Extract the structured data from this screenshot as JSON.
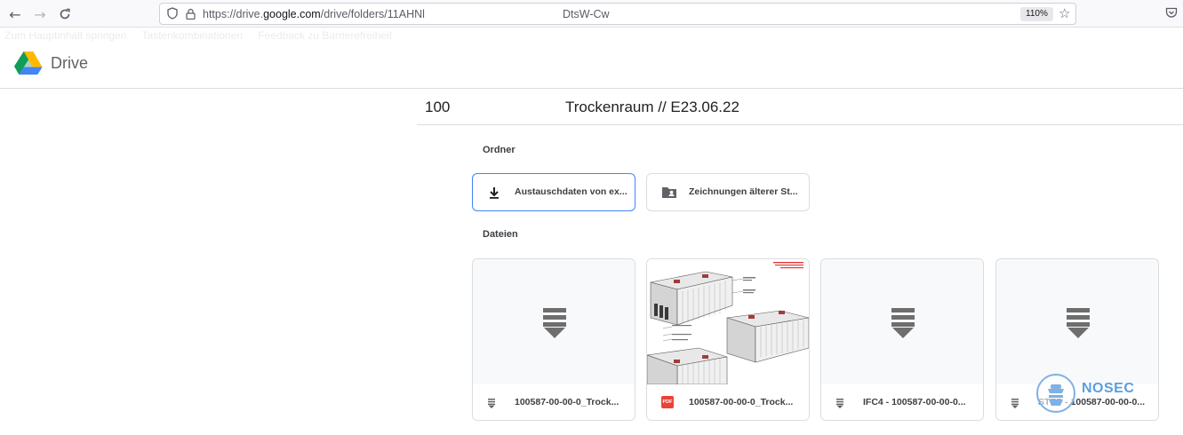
{
  "browser": {
    "url_prefix": "https://drive.",
    "url_host": "google.com",
    "url_path": "/drive/folders/11AHNl",
    "url_suffix": "DtsW-Cw",
    "zoom": "110%"
  },
  "bookmarks": [
    "Zum Hauptinhalt springen",
    "Tastenkombinationen",
    "Feedback zu Barrierefreiheit"
  ],
  "drive": {
    "app_name": "Drive"
  },
  "folder": {
    "number": "100",
    "title": "Trockenraum // E23.06.22"
  },
  "sections": {
    "folders_label": "Ordner",
    "files_label": "Dateien"
  },
  "folders": [
    {
      "label": "Austauschdaten von ex...",
      "icon": "download-icon",
      "selected": true
    },
    {
      "label": "Zeichnungen älterer St...",
      "icon": "shared-folder-icon",
      "selected": false
    }
  ],
  "files": [
    {
      "label": "100587-00-00-0_Trock...",
      "icon": "generic-file-icon"
    },
    {
      "label": "100587-00-00-0_Trock...",
      "icon": "pdf-icon",
      "badge": "PDF"
    },
    {
      "label": "IFC4 - 100587-00-00-0...",
      "icon": "generic-file-icon"
    },
    {
      "label": "STEP - 100587-00-00-0...",
      "icon": "generic-file-icon"
    }
  ],
  "watermark": {
    "text": "NOSEC"
  },
  "colors": {
    "accent": "#4285f4",
    "pdf": "#ea4335",
    "text": "#3c4043"
  }
}
